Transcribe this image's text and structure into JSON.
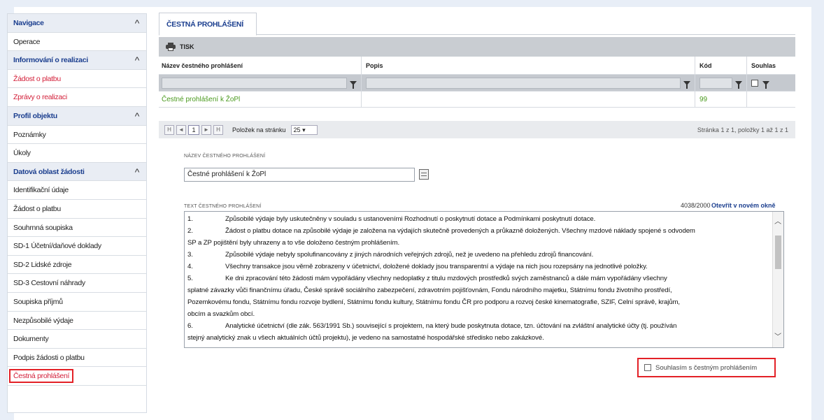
{
  "sidebar": {
    "items": [
      {
        "label": "Navigace",
        "type": "header",
        "chevron": "^"
      },
      {
        "label": "Operace",
        "type": "item"
      },
      {
        "label": "Informování o realizaci",
        "type": "header",
        "chevron": "^"
      },
      {
        "label": "Žádost o platbu",
        "type": "item-red"
      },
      {
        "label": "Zprávy o realizaci",
        "type": "item-red"
      },
      {
        "label": "Profil objektu",
        "type": "header",
        "chevron": "^"
      },
      {
        "label": "Poznámky",
        "type": "item"
      },
      {
        "label": "Úkoly",
        "type": "item"
      },
      {
        "label": "Datová oblast žádosti",
        "type": "header",
        "chevron": "^"
      },
      {
        "label": "Identifikační údaje",
        "type": "item"
      },
      {
        "label": "Žádost o platbu",
        "type": "item"
      },
      {
        "label": "Souhrnná soupiska",
        "type": "item"
      },
      {
        "label": "SD-1 Účetní/daňové doklady",
        "type": "item"
      },
      {
        "label": "SD-2 Lidské zdroje",
        "type": "item"
      },
      {
        "label": "SD-3 Cestovní náhrady",
        "type": "item"
      },
      {
        "label": "Soupiska příjmů",
        "type": "item"
      },
      {
        "label": "Nezpůsobilé výdaje",
        "type": "item"
      },
      {
        "label": "Dokumenty",
        "type": "item"
      },
      {
        "label": "Podpis žádosti o platbu",
        "type": "item"
      },
      {
        "label": "Čestná prohlášení",
        "type": "item-red-highlight"
      }
    ]
  },
  "main": {
    "tab_label": "ČESTNÁ PROHLÁŠENÍ",
    "toolbar": {
      "print_label": "TISK",
      "print_icon": "printer-icon"
    },
    "grid": {
      "headers": [
        "Název čestného prohlášení",
        "Popis",
        "Kód",
        "Souhlas"
      ],
      "rows": [
        {
          "name": "Čestné prohlášení k ŽoPl",
          "description": "",
          "code": "99",
          "agree": ""
        }
      ]
    },
    "pager": {
      "first": "H",
      "prev": "◄",
      "page": "1",
      "next": "►",
      "last": "H",
      "per_page_label": "Položek na stránku",
      "per_page_value": "25",
      "info": "Stránka 1 z 1, položky 1 až 1 z 1"
    },
    "detail": {
      "name_label": "NÁZEV ČESTNÉHO PROHLÁŠENÍ",
      "name_value": "Čestné prohlášení k ŽoPl",
      "text_label": "TEXT ČESTNÉHO PROHLÁŠENÍ",
      "counter": "4038/2000",
      "fullscreen_link": "Otevřít v novém okně",
      "text_lines": [
        {
          "n": "1.",
          "t": "Způsobilé výdaje byly uskutečněny v souladu s ustanoveními Rozhodnutí o poskytnutí dotace a Podmínkami poskytnutí dotace."
        },
        {
          "n": "2.",
          "t": "Žádost o platbu dotace na způsobilé výdaje je založena na výdajích skutečně provedených a průkazně doložených. Všechny mzdové náklady spojené s odvodem"
        },
        {
          "n": "",
          "t": "SP a ZP pojištění byly uhrazeny a to vše doloženo čestným prohlášením."
        },
        {
          "n": "3.",
          "t": "Způsobilé výdaje nebyly spolufinancovány z jiných národních veřejných zdrojů, než je uvedeno na přehledu zdrojů financování."
        },
        {
          "n": "4.",
          "t": "Všechny transakce jsou věrně zobrazeny v účetnictví, doložené doklady jsou transparentní a výdaje na nich jsou rozepsány na jednotlivé položky."
        },
        {
          "n": "5.",
          "t": "Ke dni zpracování této žádosti mám vypořádány všechny nedoplatky z titulu mzdových prostředků svých zaměstnanců a dále mám vypořádány všechny"
        },
        {
          "n": "",
          "t": "splatné závazky vůči finančnímu úřadu, České správě sociálního zabezpečení, zdravotním pojišťovnám, Fondu národního majetku, Státnímu fondu životního prostředí,"
        },
        {
          "n": "",
          "t": "Pozemkovému fondu, Státnímu fondu rozvoje bydlení, Státnímu fondu kultury, Státnímu fondu ČR pro podporu a rozvoj české kinematografie, SZIF, Celní správě, krajům,"
        },
        {
          "n": "",
          "t": "obcím a svazkům obcí."
        },
        {
          "n": "6.",
          "t": "Analytické účetnictví (dle zák. 563/1991 Sb.) související s projektem, na který bude poskytnuta dotace, tzn. účtování na zvláštní analytické účty (tj. používán"
        },
        {
          "n": "",
          "t": "stejný analytický znak u všech aktuálních účtů projektu), je vedeno na samostatné hospodářské středisko nebo zakázkové."
        }
      ],
      "agree_label": "Souhlasím s čestným prohlášením"
    }
  },
  "colors": {
    "accent_blue": "#1c3f8f",
    "link_red": "#d3203a",
    "highlight_red": "#e32127",
    "link_green": "#4a9a1e"
  }
}
